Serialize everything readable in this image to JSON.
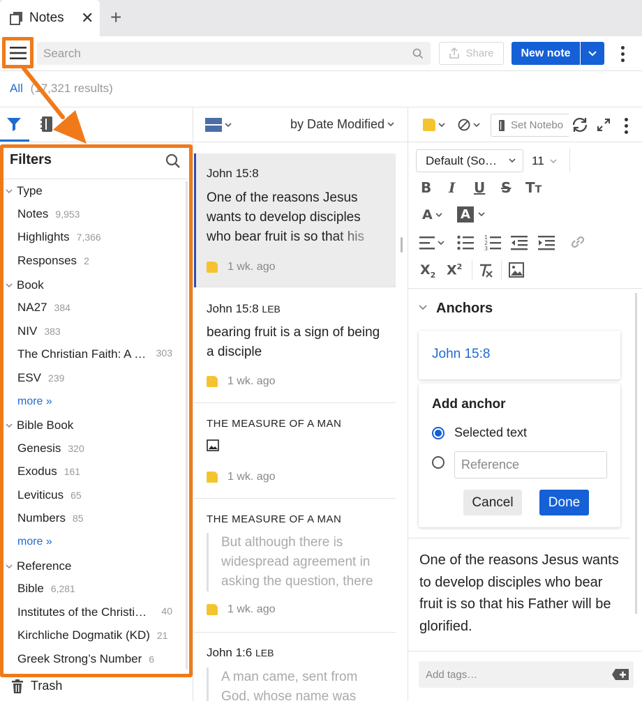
{
  "tab": {
    "label": "Notes",
    "close": "✕",
    "add": "+"
  },
  "toolbar": {
    "search_placeholder": "Search",
    "share_label": "Share",
    "new_note_label": "New note"
  },
  "results": {
    "all_label": "All",
    "count_text": "(17,321 results)"
  },
  "filters": {
    "title": "Filters",
    "groups": [
      {
        "label": "Type",
        "items": [
          {
            "label": "Notes",
            "count": "9,953"
          },
          {
            "label": "Highlights",
            "count": "7,366"
          },
          {
            "label": "Responses",
            "count": "2"
          }
        ]
      },
      {
        "label": "Book",
        "items": [
          {
            "label": "NA27",
            "count": "384"
          },
          {
            "label": "NIV",
            "count": "383"
          },
          {
            "label": "The Christian Faith: A …",
            "count": "303"
          },
          {
            "label": "ESV",
            "count": "239"
          }
        ],
        "more": "more »"
      },
      {
        "label": "Bible Book",
        "items": [
          {
            "label": "Genesis",
            "count": "320"
          },
          {
            "label": "Exodus",
            "count": "161"
          },
          {
            "label": "Leviticus",
            "count": "65"
          },
          {
            "label": "Numbers",
            "count": "85"
          }
        ],
        "more": "more »"
      },
      {
        "label": "Reference",
        "items": [
          {
            "label": "Bible",
            "count": "6,281"
          },
          {
            "label": "Institutes of the Christi…",
            "count": "40"
          },
          {
            "label": "Kirchliche Dogmatik (KD)",
            "count": "21"
          },
          {
            "label": "Greek Strong’s Number",
            "count": "6"
          }
        ]
      }
    ]
  },
  "trash_label": "Trash",
  "list": {
    "sort_label": "by Date Modified",
    "cards": [
      {
        "title": "John 15:8",
        "body": "One of the reasons Jesus wants to develop disciples who bear fruit is so that his",
        "time": "1 wk. ago"
      },
      {
        "title": "John 15:8",
        "title_suffix": "LEB",
        "body": "bearing fruit is a sign of being a disciple",
        "time": "1 wk. ago"
      },
      {
        "title": "THE MEASURE OF A MAN",
        "time": "1 wk. ago"
      },
      {
        "title": "THE MEASURE OF A MAN",
        "quote": "But although there is widespread agreement in asking the question, there",
        "time": "1 wk. ago"
      },
      {
        "title": "John 1:6",
        "title_suffix": "LEB",
        "quote": "A man came, sent from God, whose name was"
      }
    ]
  },
  "editor": {
    "set_notebook": "Set Notebo",
    "font_name": "Default (So…",
    "font_size": "11",
    "anchors_title": "Anchors",
    "anchor_link": "John 15:8",
    "add_anchor_title": "Add anchor",
    "option_selected": "Selected text",
    "reference_placeholder": "Reference",
    "cancel_label": "Cancel",
    "done_label": "Done",
    "note_text": "One of the reasons Jesus wants to develop disciples who bear fruit is so that his Father will be glorified.",
    "tags_placeholder": "Add tags…"
  },
  "colors": {
    "accent": "#1560d6",
    "highlight_orange": "#f07a1a",
    "note_yellow": "#f4c430"
  }
}
